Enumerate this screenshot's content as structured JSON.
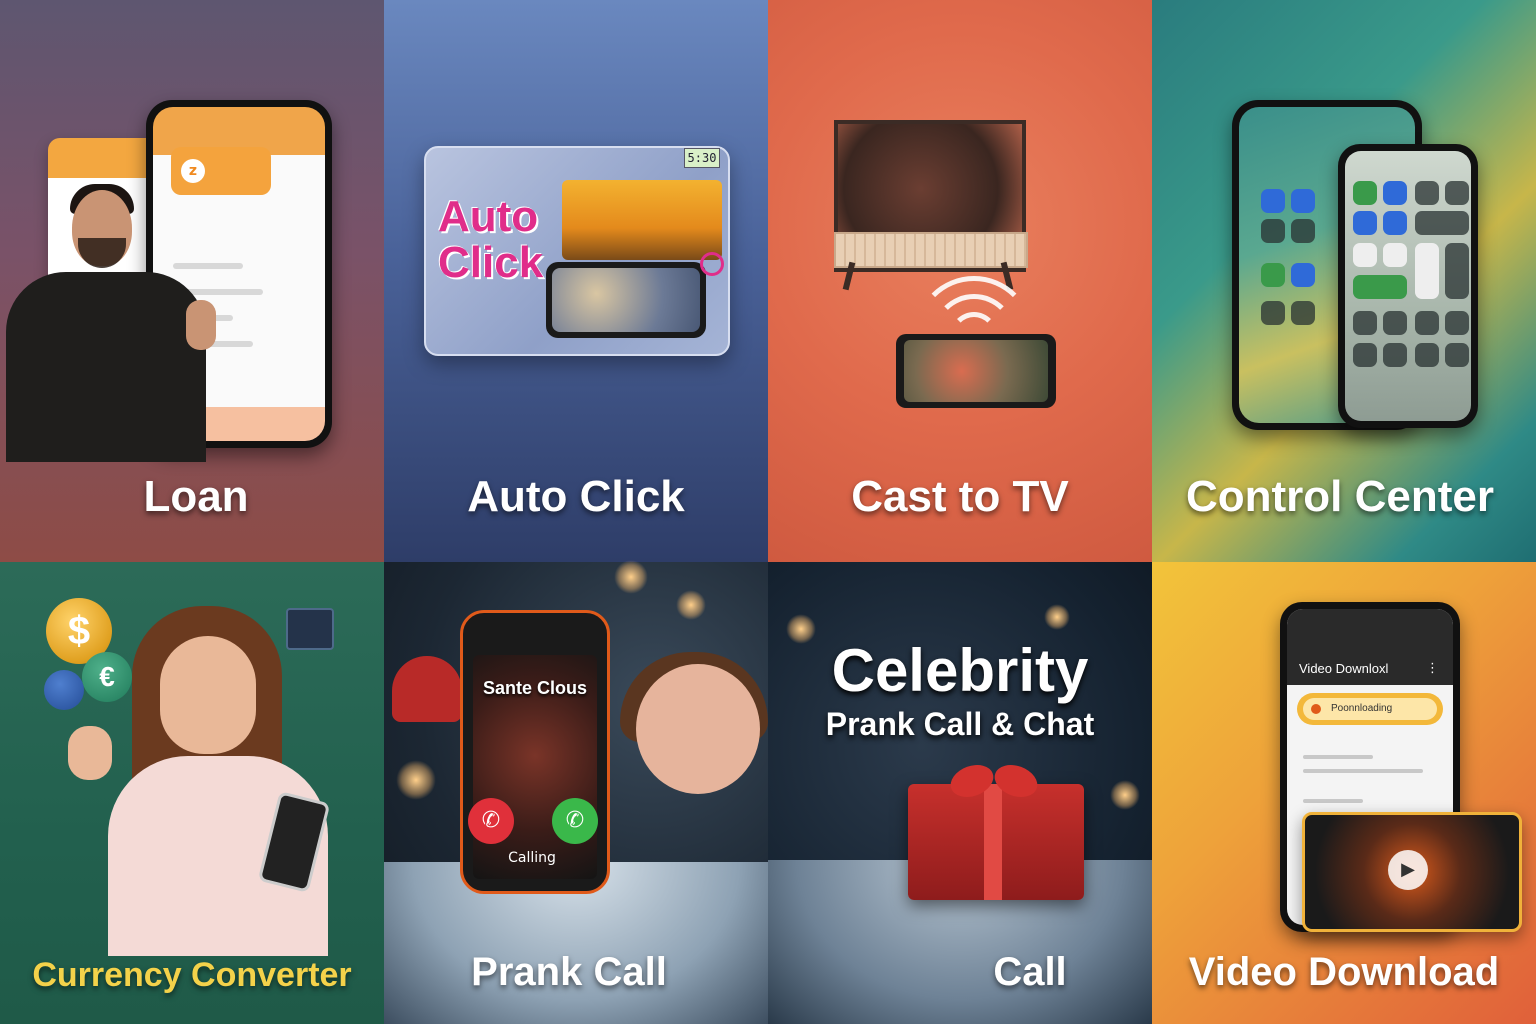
{
  "tiles": [
    {
      "caption": "Loan"
    },
    {
      "caption": "Auto Click",
      "art_title": "Auto Click",
      "timer": "5:30"
    },
    {
      "caption": "Cast to TV"
    },
    {
      "caption": "Control Center"
    },
    {
      "caption": "Currency Converter",
      "caption_color": "#f4d24a"
    },
    {
      "caption": "Prank Call",
      "contact_name": "Sante Clous",
      "status": "Calling"
    },
    {
      "caption": "Call",
      "title": "Celebrity",
      "subtitle": "Prank Call & Chat"
    },
    {
      "caption": "Video Download",
      "app_title": "Video Downloxl",
      "progress_label": "Poonnloading"
    }
  ],
  "icons": [
    "phone-icon",
    "hangup-icon",
    "play-icon",
    "menu-icon",
    "dollar-coin-icon",
    "euro-coin-icon",
    "wifi-cast-icon"
  ]
}
